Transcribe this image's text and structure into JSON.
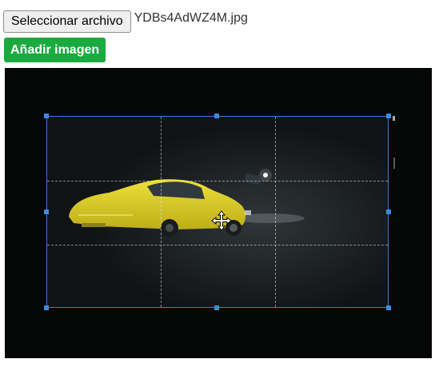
{
  "file_input": {
    "button_label": "Seleccionar archivo",
    "file_name": "YDBs4AdWZ4M.jpg"
  },
  "add_button": {
    "label": "Añadir imagen"
  },
  "colors": {
    "add_button": "#1aaa3f",
    "crop_border": "#3a7bd5",
    "car": "#e8d615"
  },
  "icons": {
    "cursor": "move-cursor-icon"
  }
}
